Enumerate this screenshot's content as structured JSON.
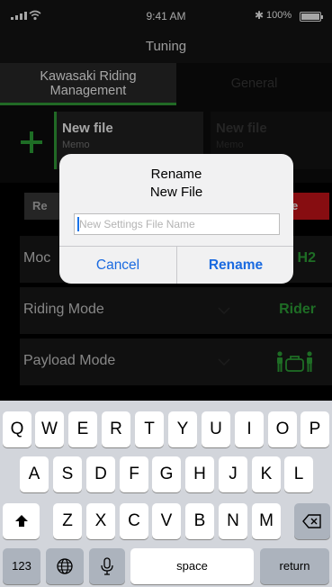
{
  "status_bar": {
    "time": "9:41 AM",
    "bluetooth": "✱",
    "battery_pct": "100%"
  },
  "app": {
    "title": "Tuning"
  },
  "tabs": [
    {
      "line1": "Kawasaki Riding",
      "line2": "Management"
    },
    {
      "label": "General"
    }
  ],
  "files": [
    {
      "name": "New file",
      "memo": "Memo"
    },
    {
      "name": "New file",
      "memo": "Memo"
    }
  ],
  "actions": {
    "left_label": "Re",
    "right_label": "e"
  },
  "settings": [
    {
      "label": "Moc",
      "value": "H2"
    },
    {
      "label": "Riding Mode",
      "value": "Rider"
    },
    {
      "label": "Payload Mode",
      "value_icon": "rider-with-luggage-icon"
    }
  ],
  "dialog": {
    "title_line1": "Rename",
    "title_line2": "New File",
    "placeholder": "New Settings File Name",
    "cancel_label": "Cancel",
    "rename_label": "Rename"
  },
  "keyboard": {
    "row1": [
      "Q",
      "W",
      "E",
      "R",
      "T",
      "Y",
      "U",
      "I",
      "O",
      "P"
    ],
    "row2": [
      "A",
      "S",
      "D",
      "F",
      "G",
      "H",
      "J",
      "K",
      "L"
    ],
    "row3": [
      "Z",
      "X",
      "C",
      "V",
      "B",
      "N",
      "M"
    ],
    "numbers_label": "123",
    "space_label": "space",
    "return_label": "return"
  },
  "colors": {
    "accent_green": "#2fa83a",
    "delete_red": "#d0141b",
    "ios_blue": "#1a6ae0"
  }
}
